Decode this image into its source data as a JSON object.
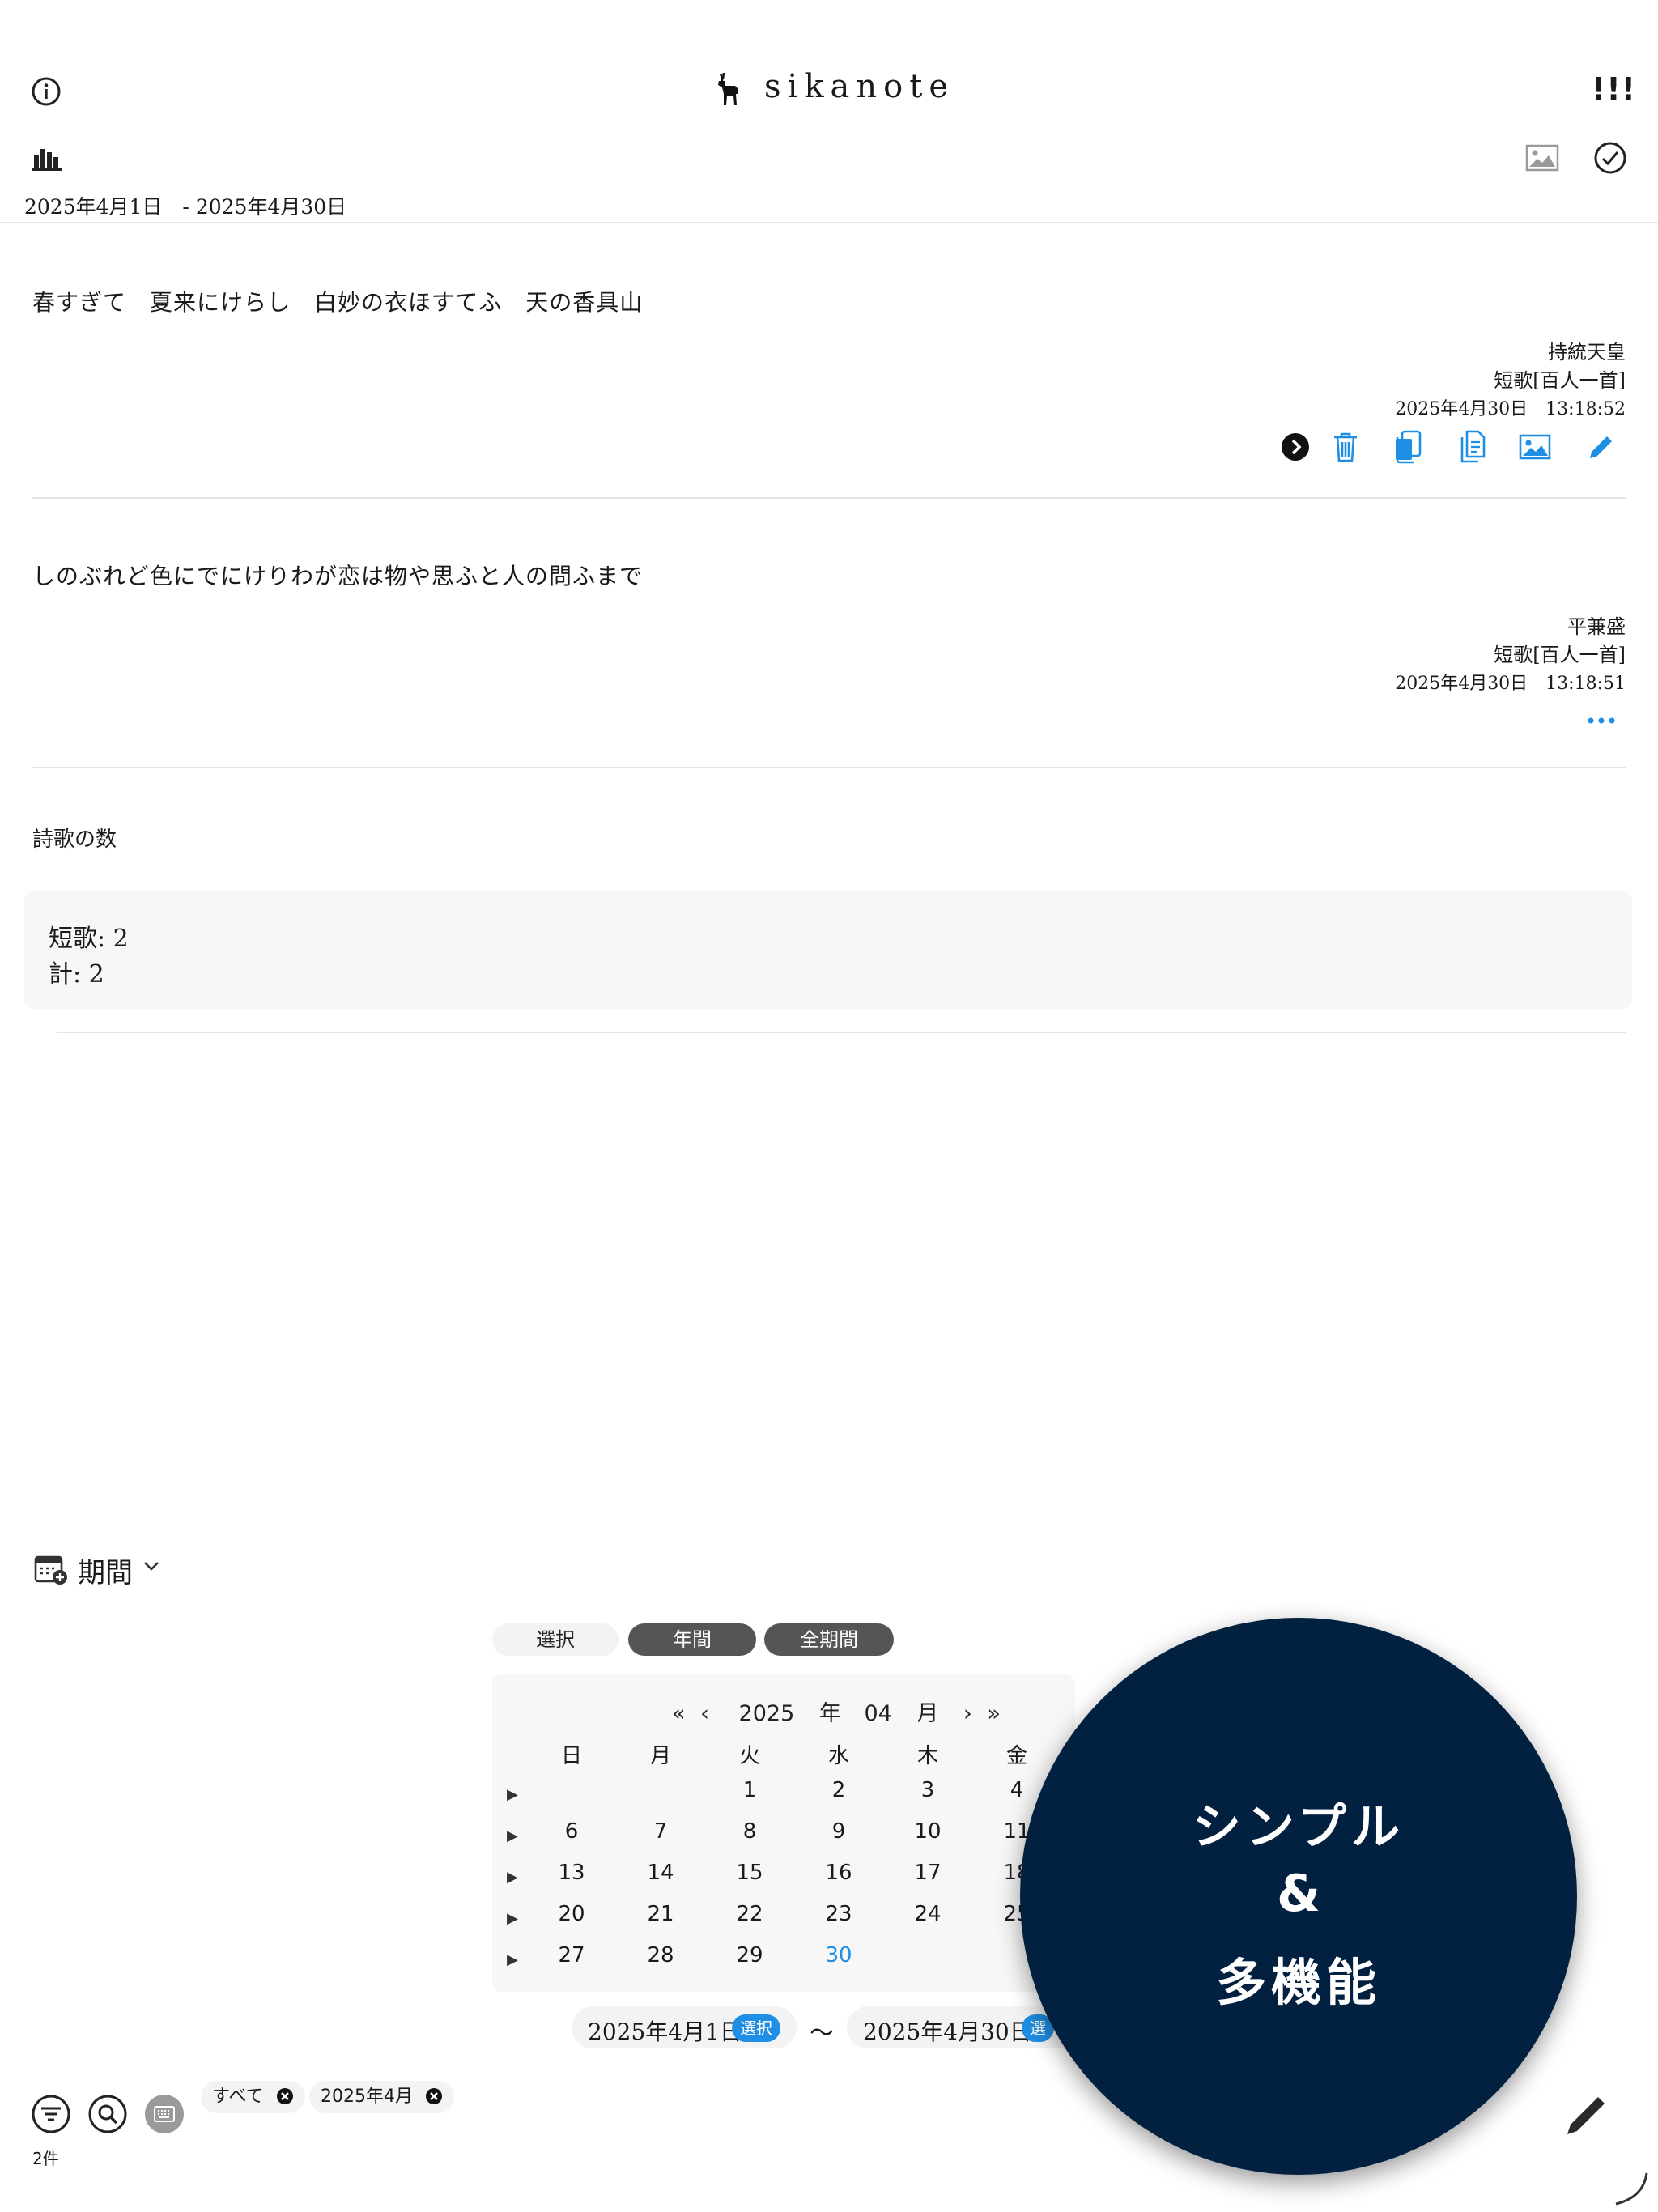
{
  "header": {
    "app_name": "sikanote",
    "menu_label": "!!!"
  },
  "date_range": {
    "label": "2025年4月1日　- 2025年4月30日"
  },
  "entries": [
    {
      "text": "春すぎて　夏来にけらし　白妙の衣ほすてふ　天の香具山",
      "author": "持統天皇",
      "category": "短歌[百人一首]",
      "timestamp": "2025年4月30日　13:18:52"
    },
    {
      "text": "しのぶれど色にでにけりわが恋は物や思ふと人の問ふまで",
      "author": "平兼盛",
      "category": "短歌[百人一首]",
      "timestamp": "2025年4月30日　13:18:51"
    }
  ],
  "stats": {
    "title": "詩歌の数",
    "tanka": "短歌: 2",
    "total": "計: 2"
  },
  "period": {
    "label": "期間",
    "segments": [
      "選択",
      "年間",
      "全期間"
    ],
    "year": "2025",
    "year_unit": "年",
    "month": "04",
    "month_unit": "月",
    "weekdays": [
      "日",
      "月",
      "火",
      "水",
      "木",
      "金"
    ],
    "weeks": [
      [
        "",
        "",
        "1",
        "2",
        "3",
        "4"
      ],
      [
        "6",
        "7",
        "8",
        "9",
        "10",
        "11"
      ],
      [
        "13",
        "14",
        "15",
        "16",
        "17",
        "18"
      ],
      [
        "20",
        "21",
        "22",
        "23",
        "24",
        "25"
      ],
      [
        "27",
        "28",
        "29",
        "30",
        "",
        ""
      ]
    ],
    "selected_day": "30",
    "start_date": "2025年4月1日",
    "end_date": "2025年4月30日",
    "select_label": "選択",
    "select_label_partial": "選",
    "tilde": "〜"
  },
  "promo": {
    "line1": "シンプル",
    "line2": "&",
    "line3": "多機能"
  },
  "footer": {
    "chip_all": "すべて",
    "chip_month": "2025年4月",
    "count": "2件"
  },
  "colors": {
    "accent": "#1f8fe5",
    "promo_bg": "#02203f",
    "segment_dark": "#555558"
  }
}
